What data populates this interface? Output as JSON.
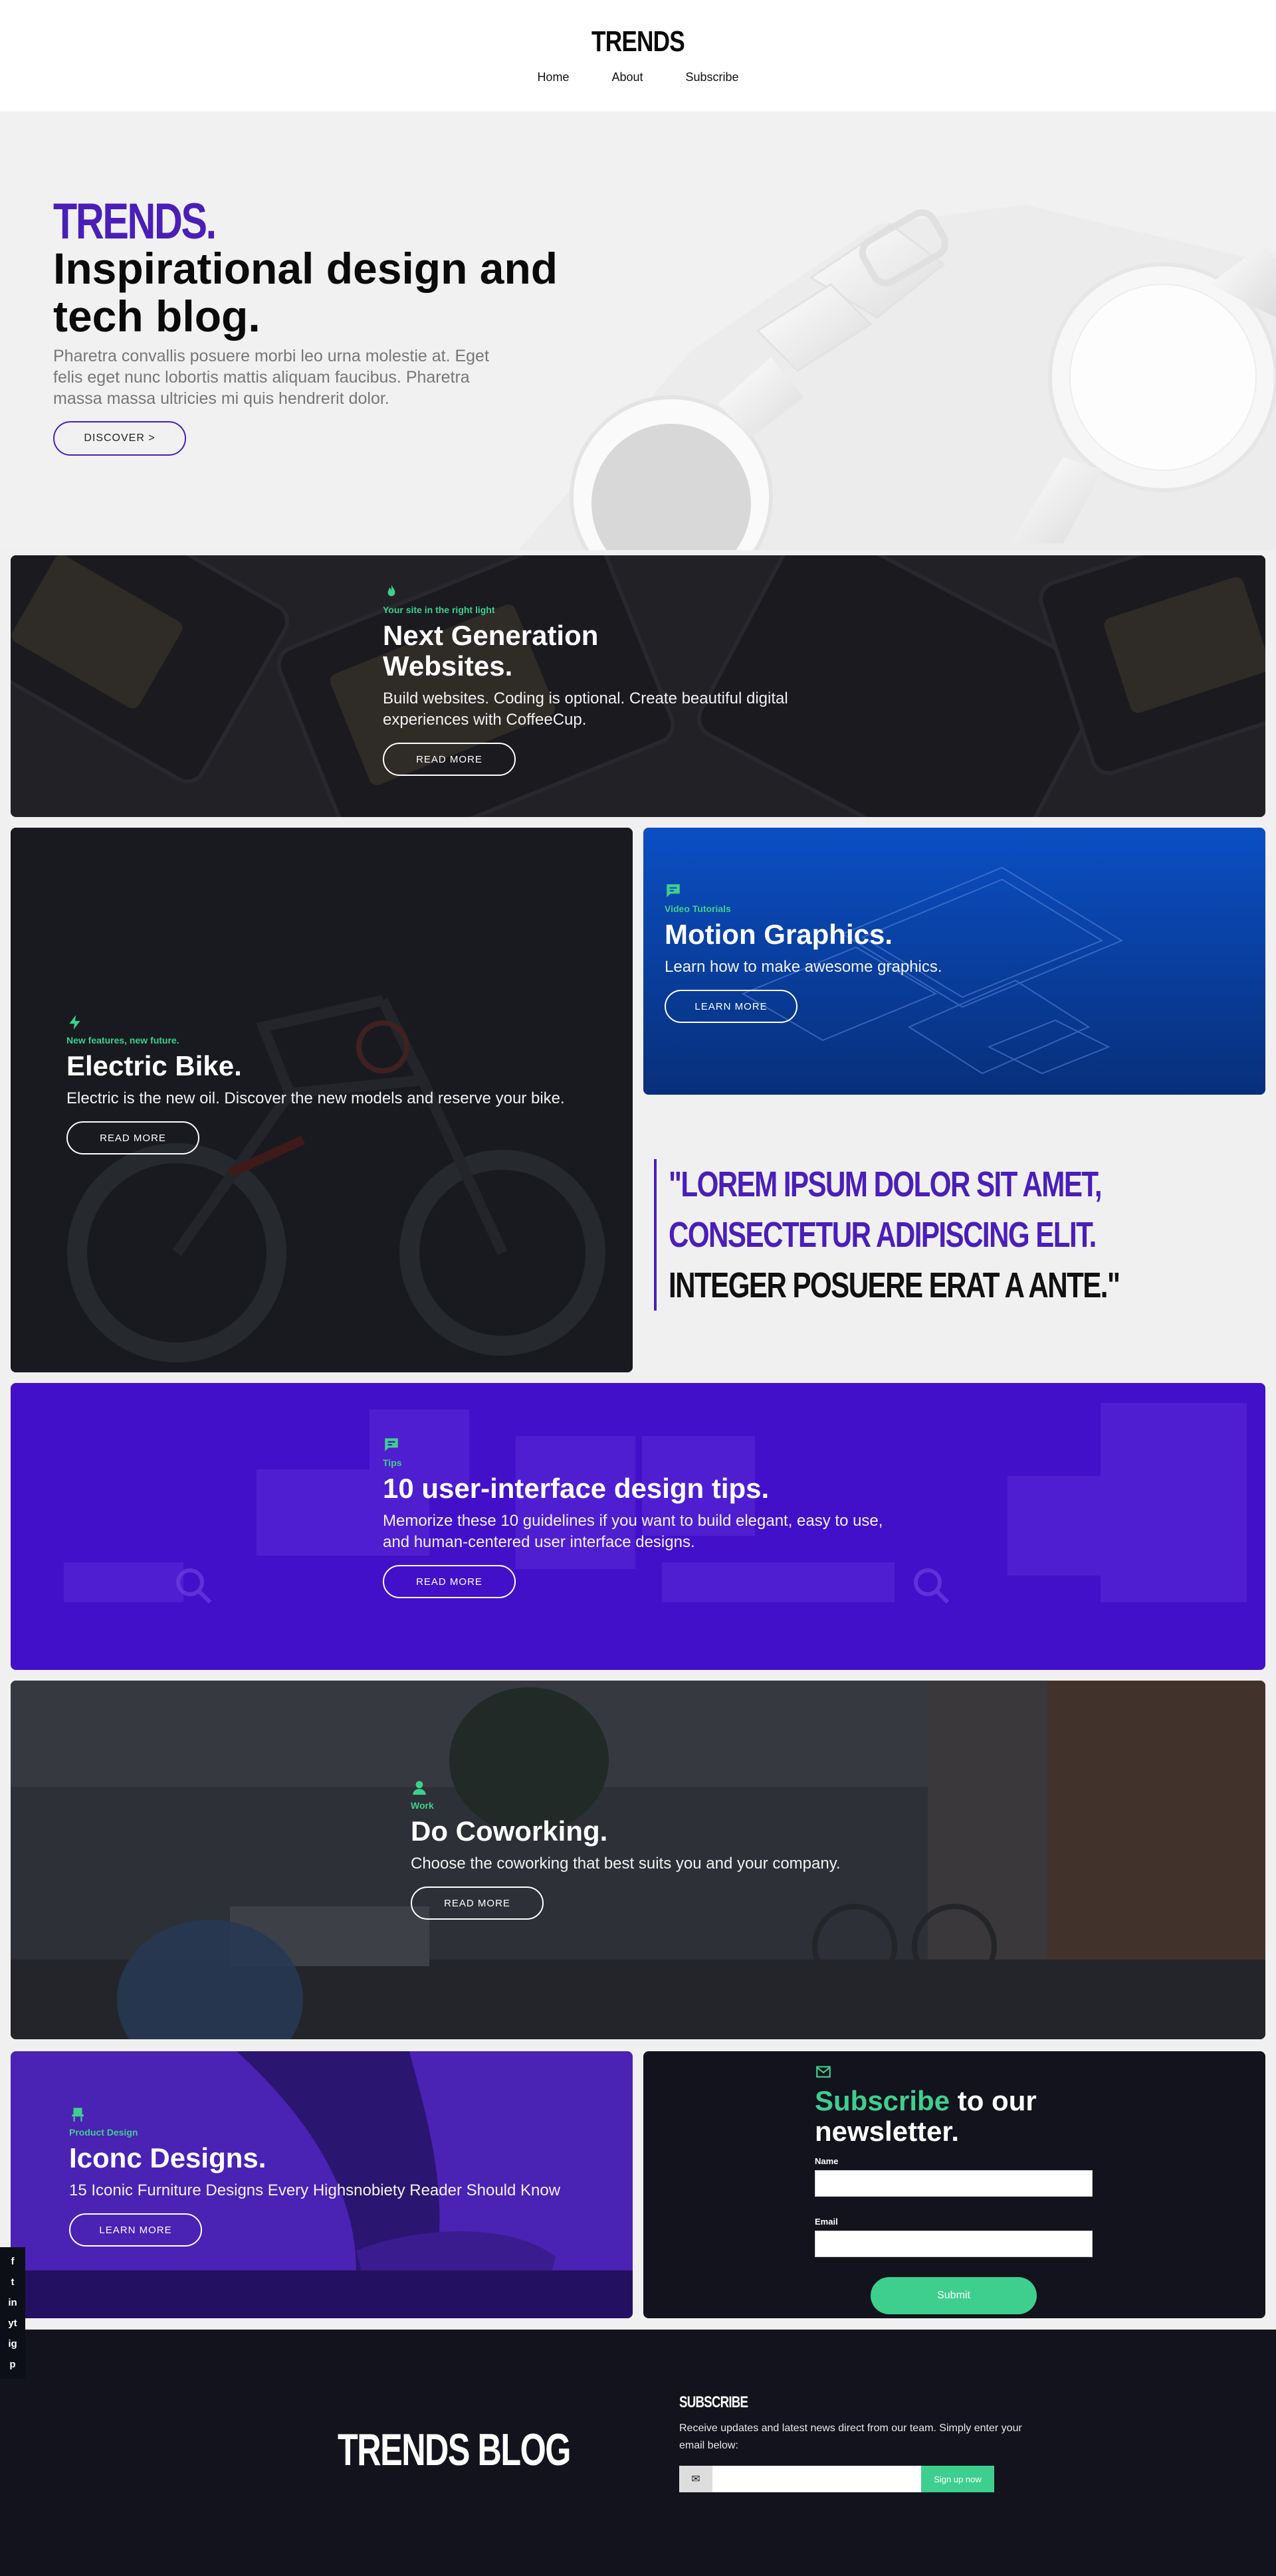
{
  "header": {
    "logo": "TRENDS",
    "nav": [
      "Home",
      "About",
      "Subscribe"
    ]
  },
  "hero": {
    "brand": "TRENDS.",
    "title": "Inspirational design and tech blog.",
    "text": "Pharetra convallis posuere morbi leo urna molestie at. Eget felis eget nunc lobortis mattis aliquam faucibus. Pharetra massa massa ultricies mi quis hendrerit dolor.",
    "button": "DISCOVER >"
  },
  "cards": {
    "websites": {
      "icon": "flame-icon",
      "eyebrow": "Your site in the right light",
      "title": "Next Generation Websites.",
      "text": "Build websites. Coding is optional. Create beautiful digital experiences with CoffeeCup.",
      "button": "READ MORE"
    },
    "bike": {
      "icon": "bolt-icon",
      "eyebrow": "New features, new future.",
      "title": "Electric Bike.",
      "text": "Electric is the new oil. Discover the new models and reserve your bike.",
      "button": "READ MORE"
    },
    "motion": {
      "icon": "chat-icon",
      "eyebrow": "Video Tutorials",
      "title": "Motion Graphics.",
      "text": "Learn how to make awesome graphics.",
      "button": "LEARN MORE"
    },
    "tips": {
      "icon": "chat-icon",
      "eyebrow": "Tips",
      "title": "10 user-interface design tips.",
      "text": "Memorize these 10 guidelines if you want to build elegant, easy to use, and human-centered user interface designs.",
      "button": "READ MORE"
    },
    "cowork": {
      "icon": "user-icon",
      "eyebrow": "Work",
      "title": "Do Coworking.",
      "text": "Choose the coworking that best suits you and your company.",
      "button": "READ MORE"
    },
    "iconic": {
      "icon": "chair-icon",
      "eyebrow": "Product Design",
      "title": "Iconc Designs.",
      "text": "15 Iconic Furniture Designs Every Highsnobiety Reader Should Know",
      "button": "LEARN MORE"
    }
  },
  "quote": {
    "highlight": "\"Lorem ipsum dolor sit amet, consectetur adipiscing elit.",
    "rest": " Integer posuere erat a ante.\""
  },
  "newsletter": {
    "icon": "envelope-icon",
    "title_green": "Subscribe",
    "title_rest": " to our newsletter.",
    "name_label": "Name",
    "email_label": "Email",
    "submit": "Submit"
  },
  "social": [
    "f",
    "t",
    "in",
    "yt",
    "ig",
    "p"
  ],
  "footer": {
    "logo": "TRENDS BLOG",
    "subscribe_heading": "SUBSCRIBE",
    "subscribe_text": "Receive updates and latest news direct from our team. Simply enter your email below:",
    "button": "Sign up now"
  },
  "colors": {
    "brand_purple": "#4a1fb8",
    "accent_green": "#3ecf8e",
    "dark": "#12131c"
  }
}
